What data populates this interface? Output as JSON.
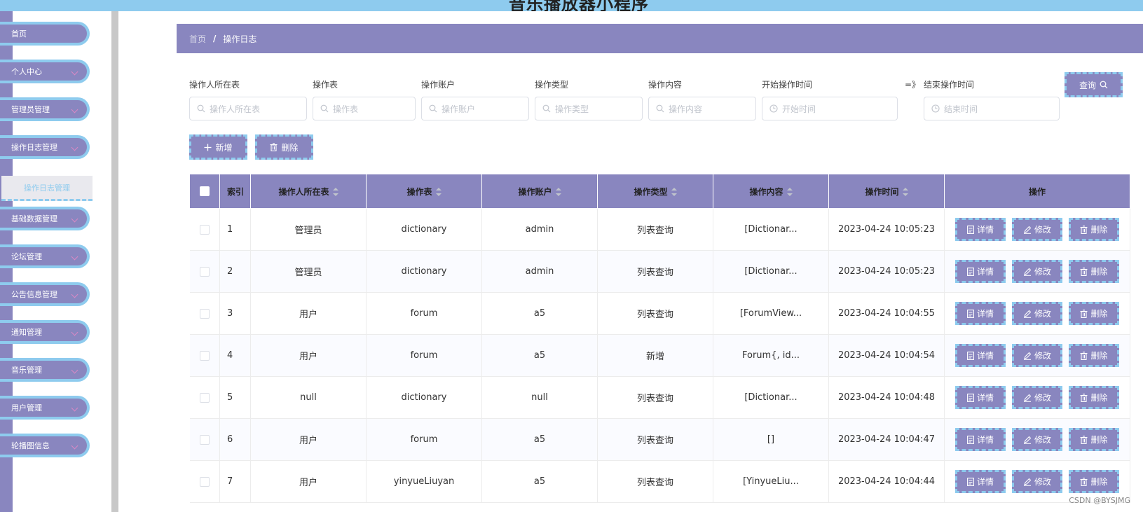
{
  "header": {
    "title": "音乐播放器小程序"
  },
  "sidebar": {
    "items": [
      {
        "label": "首页",
        "icon": "chevron-icon"
      },
      {
        "label": "个人中心",
        "icon": "chevron-down-icon"
      },
      {
        "label": "管理员管理",
        "icon": "chevron-down-icon"
      },
      {
        "label": "操作日志管理",
        "icon": "chevron-down-icon"
      },
      {
        "label": "基础数据管理",
        "icon": "chevron-down-icon"
      },
      {
        "label": "论坛管理",
        "icon": "chevron-down-icon"
      },
      {
        "label": "公告信息管理",
        "icon": "chevron-down-icon"
      },
      {
        "label": "通知管理",
        "icon": "chevron-down-icon"
      },
      {
        "label": "音乐管理",
        "icon": "chevron-down-icon"
      },
      {
        "label": "用户管理",
        "icon": "chevron-down-icon"
      },
      {
        "label": "轮播图信息",
        "icon": "chevron-down-icon"
      }
    ],
    "active_sub": "操作日志管理"
  },
  "breadcrumb": {
    "home": "首页",
    "separator": "/",
    "current": "操作日志"
  },
  "search": {
    "fields": [
      {
        "label": "操作人所在表",
        "placeholder": "操作人所在表"
      },
      {
        "label": "操作表",
        "placeholder": "操作表"
      },
      {
        "label": "操作账户",
        "placeholder": "操作账户"
      },
      {
        "label": "操作类型",
        "placeholder": "操作类型"
      },
      {
        "label": "操作内容",
        "placeholder": "操作内容"
      },
      {
        "label": "开始操作时间",
        "placeholder": "开始时间"
      },
      {
        "label": "结束操作时间",
        "placeholder": "结束时间"
      }
    ],
    "range_separator": "=》",
    "query_label": "查询"
  },
  "actions": {
    "add_label": "新增",
    "delete_label": "删除"
  },
  "table": {
    "columns": [
      "索引",
      "操作人所在表",
      "操作表",
      "操作账户",
      "操作类型",
      "操作内容",
      "操作时间",
      "操作"
    ],
    "rows": [
      {
        "index": "1",
        "user_table": "管理员",
        "table": "dictionary",
        "account": "admin",
        "type": "列表查询",
        "content": "[Dictionar...",
        "time": "2023-04-24 10:05:23"
      },
      {
        "index": "2",
        "user_table": "管理员",
        "table": "dictionary",
        "account": "admin",
        "type": "列表查询",
        "content": "[Dictionar...",
        "time": "2023-04-24 10:05:23"
      },
      {
        "index": "3",
        "user_table": "用户",
        "table": "forum",
        "account": "a5",
        "type": "列表查询",
        "content": "[ForumView...",
        "time": "2023-04-24 10:04:55"
      },
      {
        "index": "4",
        "user_table": "用户",
        "table": "forum",
        "account": "a5",
        "type": "新增",
        "content": "Forum{, id...",
        "time": "2023-04-24 10:04:54"
      },
      {
        "index": "5",
        "user_table": "null",
        "table": "dictionary",
        "account": "null",
        "type": "列表查询",
        "content": "[Dictionar...",
        "time": "2023-04-24 10:04:48"
      },
      {
        "index": "6",
        "user_table": "用户",
        "table": "forum",
        "account": "a5",
        "type": "列表查询",
        "content": "[]",
        "time": "2023-04-24 10:04:47"
      },
      {
        "index": "7",
        "user_table": "用户",
        "table": "yinyueLiuyan",
        "account": "a5",
        "type": "列表查询",
        "content": "[YinyueLiu...",
        "time": "2023-04-24 10:04:44"
      }
    ],
    "row_actions": {
      "detail": "详情",
      "edit": "修改",
      "delete": "删除"
    }
  },
  "watermark": "CSDN @BYSJMG",
  "colors": {
    "primary": "#8986bf",
    "accent": "#8ecbee",
    "header": "#8ecbee"
  }
}
